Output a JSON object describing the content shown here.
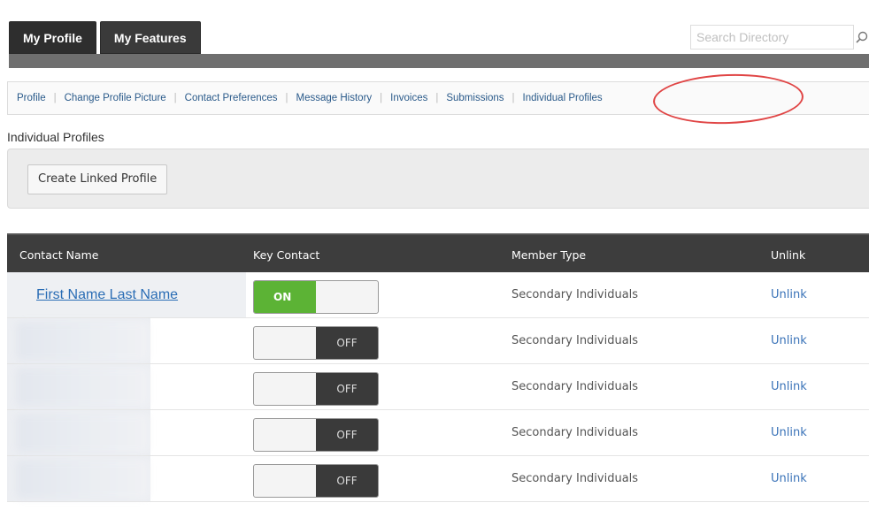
{
  "header": {
    "tabs": [
      {
        "label": "My Profile"
      },
      {
        "label": "My Features"
      }
    ],
    "search_placeholder": "Search Directory"
  },
  "subnav": {
    "items": [
      {
        "label": "Profile"
      },
      {
        "label": "Change Profile Picture"
      },
      {
        "label": "Contact Preferences"
      },
      {
        "label": "Message History"
      },
      {
        "label": "Invoices"
      },
      {
        "label": "Submissions"
      },
      {
        "label": "Individual Profiles"
      }
    ],
    "separator": "|",
    "highlight_color": "#e04545"
  },
  "section_title": "Individual Profiles",
  "create_button_label": "Create Linked Profile",
  "table": {
    "headers": {
      "contact_name": "Contact Name",
      "key_contact": "Key Contact",
      "member_type": "Member Type",
      "unlink": "Unlink"
    },
    "rows": [
      {
        "name": "First Name  Last Name",
        "key_contact": "ON",
        "member_type": "Secondary Individuals",
        "unlink": "Unlink"
      },
      {
        "name": "",
        "key_contact": "OFF",
        "member_type": "Secondary Individuals",
        "unlink": "Unlink"
      },
      {
        "name": "",
        "key_contact": "OFF",
        "member_type": "Secondary Individuals",
        "unlink": "Unlink"
      },
      {
        "name": "",
        "key_contact": "OFF",
        "member_type": "Secondary Individuals",
        "unlink": "Unlink"
      },
      {
        "name": "",
        "key_contact": "OFF",
        "member_type": "Secondary Individuals",
        "unlink": "Unlink"
      }
    ]
  },
  "colors": {
    "toggle_on": "#5cb335",
    "toggle_off": "#3a3a3a",
    "link": "#3a73b8",
    "header_dark": "#3d3d3d"
  }
}
